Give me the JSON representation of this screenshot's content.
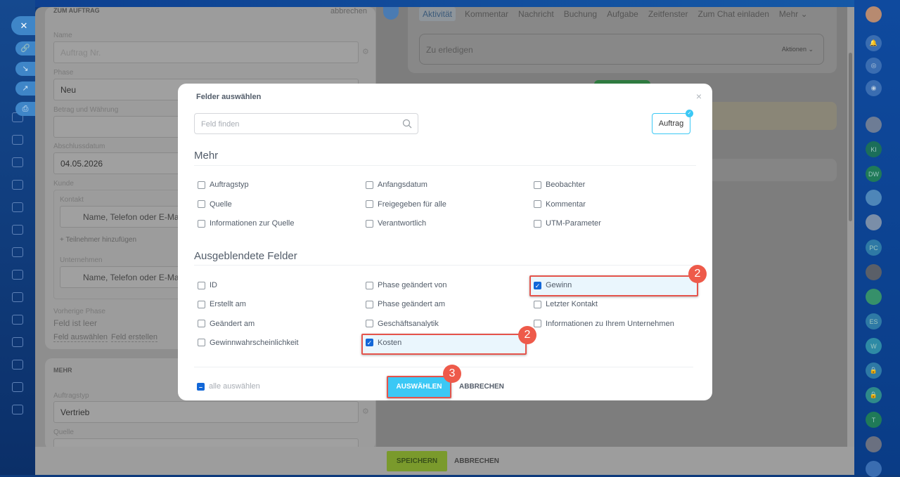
{
  "form": {
    "title": "ZUM AUFTRAG",
    "cancel": "abbrechen",
    "name_label": "Name",
    "name_placeholder": "Auftrag Nr.",
    "phase_label": "Phase",
    "phase_value": "Neu",
    "amount_label": "Betrag und Währung",
    "close_date_label": "Abschlussdatum",
    "close_date_value": "04.05.2026",
    "client_label": "Kunde",
    "contact_label": "Kontakt",
    "contact_placeholder": "Name, Telefon oder E-Mail",
    "add_participant": "+ Teilnehmer hinzufügen",
    "company_label": "Unternehmen",
    "company_placeholder": "Name, Telefon oder E-Mail",
    "prev_phase_label": "Vorherige Phase",
    "prev_phase_value": "Feld ist leer",
    "select_field": "Feld auswählen",
    "create_field": "Feld erstellen",
    "more_title": "MEHR",
    "order_type_label": "Auftragstyp",
    "order_type_value": "Vertrieb",
    "source_label": "Quelle"
  },
  "timeline": {
    "tabs": [
      "Aktivität",
      "Kommentar",
      "Nachricht",
      "Buchung",
      "Aufgabe",
      "Zeitfenster",
      "Zum Chat einladen",
      "Mehr ⌄"
    ],
    "todo_placeholder": "Zu erledigen",
    "actions": "Aktionen ⌄"
  },
  "footer": {
    "save": "SPEICHERN",
    "cancel": "ABBRECHEN"
  },
  "rightnav": [
    "KI",
    "DW",
    "PC",
    "ES",
    "W",
    "T"
  ],
  "modal": {
    "title": "Felder auswählen",
    "close": "×",
    "search_placeholder": "Feld finden",
    "entity_button": "Auftrag",
    "section_more": "Mehr",
    "more_fields": [
      [
        "Auftragstyp",
        "Anfangsdatum",
        "Beobachter"
      ],
      [
        "Quelle",
        "Freigegeben für alle",
        "Kommentar"
      ],
      [
        "Informationen zur Quelle",
        "Verantwortlich",
        "UTM-Parameter"
      ]
    ],
    "section_hidden": "Ausgeblendete Felder",
    "hidden_fields": [
      [
        "ID",
        "Phase geändert von",
        "Gewinn"
      ],
      [
        "Erstellt am",
        "Phase geändert am",
        "Letzter Kontakt"
      ],
      [
        "Geändert am",
        "Geschäftsanalytik",
        "Informationen zu Ihrem Unternehmen"
      ],
      [
        "Gewinnwahrscheinlichkeit",
        "Kosten",
        ""
      ]
    ],
    "checked": [
      "Gewinn",
      "Kosten"
    ],
    "select_all": "alle auswählen",
    "confirm": "AUSWÄHLEN",
    "cancel": "ABBRECHEN"
  },
  "annotations": [
    "2",
    "2",
    "3"
  ],
  "colors": {
    "accent": "#3bc8f5",
    "highlight": "#e5534b",
    "checkbox": "#1267d8"
  }
}
